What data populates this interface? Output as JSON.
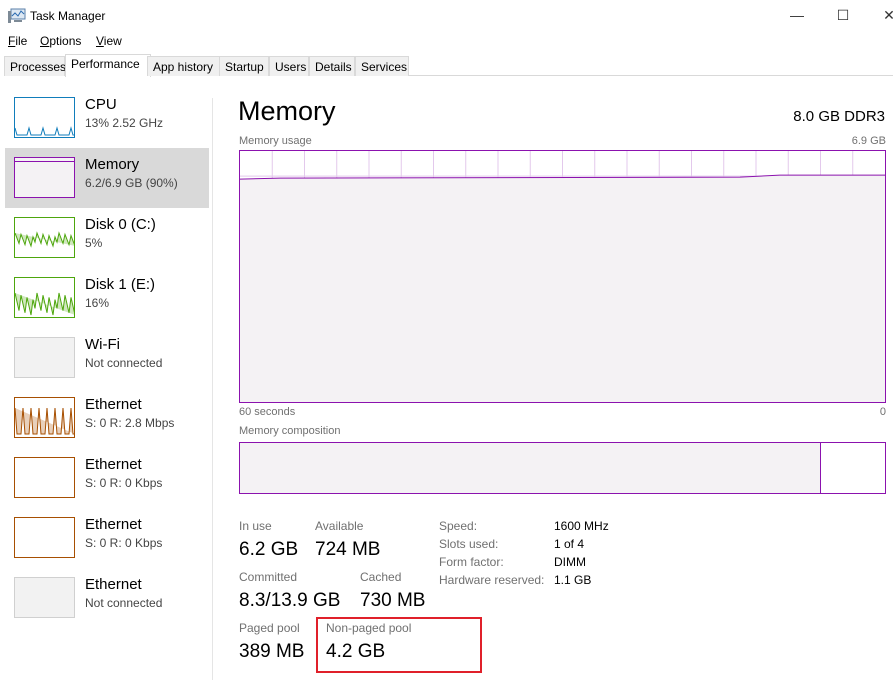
{
  "window": {
    "title": "Task Manager",
    "minimize": "—",
    "maximize": "☐",
    "close": "✕"
  },
  "menu": [
    {
      "label": "File",
      "key": "F",
      "rest": "ile"
    },
    {
      "label": "Options",
      "key": "O",
      "rest": "ptions"
    },
    {
      "label": "View",
      "key": "V",
      "rest": "iew"
    }
  ],
  "tabs": [
    "Processes",
    "Performance",
    "App history",
    "Startup",
    "Users",
    "Details",
    "Services"
  ],
  "active_tab": "Performance",
  "sidebar": [
    {
      "name": "CPU",
      "sub": "13% 2.52 GHz",
      "color": "#117dbb"
    },
    {
      "name": "Memory",
      "sub": "6.2/6.9 GB (90%)",
      "color": "#8b12ae"
    },
    {
      "name": "Disk 0 (C:)",
      "sub": "5%",
      "color": "#4da60c"
    },
    {
      "name": "Disk 1 (E:)",
      "sub": "16%",
      "color": "#4da60c"
    },
    {
      "name": "Wi-Fi",
      "sub": "Not connected",
      "color": "#bcbcbc"
    },
    {
      "name": "Ethernet",
      "sub": "S: 0 R: 2.8 Mbps",
      "color": "#a74f01"
    },
    {
      "name": "Ethernet",
      "sub": "S: 0 R: 0 Kbps",
      "color": "#a74f01"
    },
    {
      "name": "Ethernet",
      "sub": "S: 0 R: 0 Kbps",
      "color": "#a74f01"
    },
    {
      "name": "Ethernet",
      "sub": "Not connected",
      "color": "#bcbcbc"
    }
  ],
  "main": {
    "title": "Memory",
    "spec": "8.0 GB DDR3",
    "usage_label": "Memory usage",
    "usage_max": "6.9 GB",
    "x_left": "60 seconds",
    "x_right": "0",
    "usage_percent": 90,
    "composition_label": "Memory composition",
    "in_use_fraction": 0.9,
    "stats": {
      "in_use": {
        "label": "In use",
        "value": "6.2 GB"
      },
      "available": {
        "label": "Available",
        "value": "724 MB"
      },
      "committed": {
        "label": "Committed",
        "value": "8.3/13.9 GB"
      },
      "cached": {
        "label": "Cached",
        "value": "730 MB"
      },
      "paged": {
        "label": "Paged pool",
        "value": "389 MB"
      },
      "nonpaged": {
        "label": "Non-paged pool",
        "value": "4.2 GB"
      }
    },
    "right": [
      {
        "label": "Speed:",
        "value": "1600 MHz"
      },
      {
        "label": "Slots used:",
        "value": "1 of 4"
      },
      {
        "label": "Form factor:",
        "value": "DIMM"
      },
      {
        "label": "Hardware reserved:",
        "value": "1.1 GB"
      }
    ]
  }
}
